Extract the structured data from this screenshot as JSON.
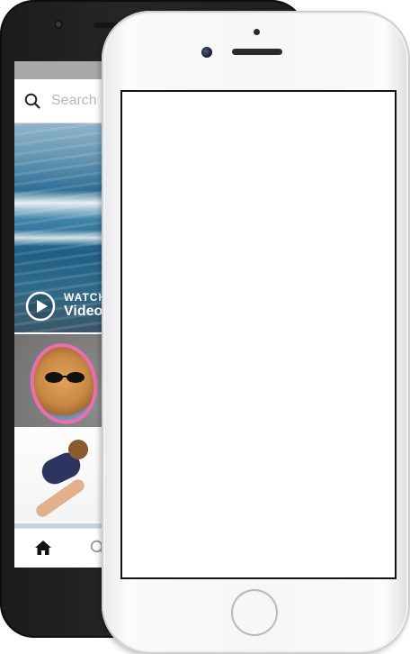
{
  "android_app": {
    "search": {
      "placeholder": "Search"
    },
    "video_tile": {
      "watch_label": "WATCH",
      "title": "Video"
    }
  },
  "icons": {
    "search": "search-icon",
    "play": "play-circle-icon",
    "home": "home-icon",
    "search_tab": "search-icon"
  },
  "colors": {
    "android_body": "#222222",
    "iphone_body": "#f6f6f7",
    "status_bar": "#a9a9a9"
  }
}
